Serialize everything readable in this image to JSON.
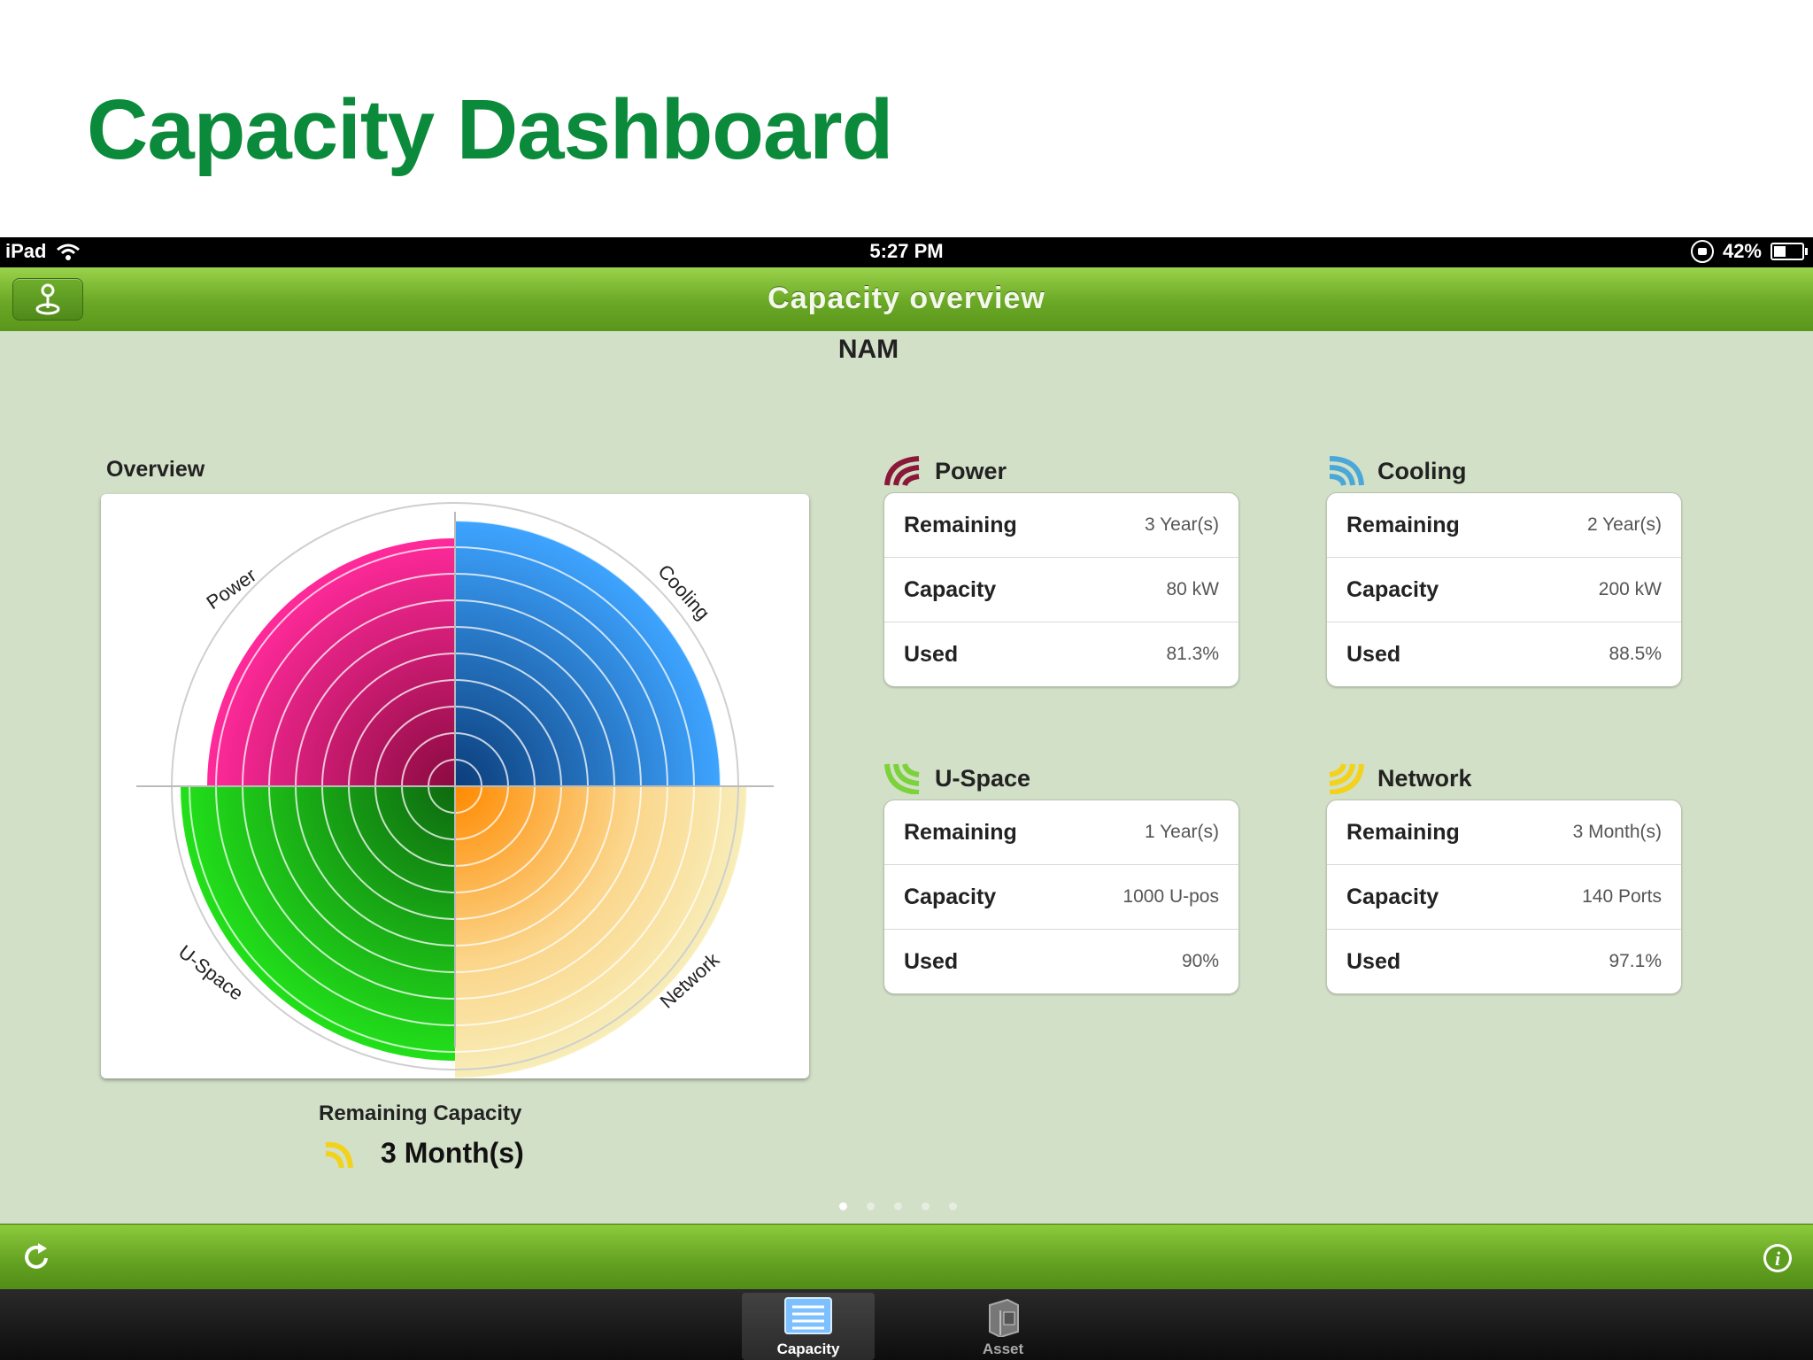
{
  "slide": {
    "title": "Capacity Dashboard"
  },
  "status_bar": {
    "device": "iPad",
    "time": "5:27 PM",
    "battery": "42%",
    "battery_level": 0.42
  },
  "nav": {
    "title": "Capacity overview",
    "left_button_icon": "location-pin-icon"
  },
  "region": "NAM",
  "overview": {
    "label": "Overview",
    "quadrant_labels": {
      "power": "Power",
      "cooling": "Cooling",
      "uspace": "U-Space",
      "network": "Network"
    },
    "colors": {
      "power": "#e0157d",
      "cooling": "#2f8fe8",
      "uspace": "#22c416",
      "network": "#f39a1c"
    },
    "remaining_label": "Remaining Capacity",
    "remaining_value": "3 Month(s)"
  },
  "panels": [
    {
      "name": "Power",
      "icon": "power-arc-icon",
      "color": "#8a1838",
      "rows": [
        {
          "k": "Remaining",
          "v": "3 Year(s)"
        },
        {
          "k": "Capacity",
          "v": "80 kW"
        },
        {
          "k": "Used",
          "v": "81.3%"
        }
      ]
    },
    {
      "name": "Cooling",
      "icon": "cooling-arc-icon",
      "color": "#4aa8d8",
      "rows": [
        {
          "k": "Remaining",
          "v": "2 Year(s)"
        },
        {
          "k": "Capacity",
          "v": "200 kW"
        },
        {
          "k": "Used",
          "v": "88.5%"
        }
      ]
    },
    {
      "name": "U-Space",
      "icon": "uspace-arc-icon",
      "color": "#7cd23a",
      "rows": [
        {
          "k": "Remaining",
          "v": "1 Year(s)"
        },
        {
          "k": "Capacity",
          "v": "1000 U-pos"
        },
        {
          "k": "Used",
          "v": "90%"
        }
      ]
    },
    {
      "name": "Network",
      "icon": "network-arc-icon",
      "color": "#f2d21a",
      "rows": [
        {
          "k": "Remaining",
          "v": "3 Month(s)"
        },
        {
          "k": "Capacity",
          "v": "140 Ports"
        },
        {
          "k": "Used",
          "v": "97.1%"
        }
      ]
    }
  ],
  "page_indicator": {
    "count": 5,
    "active": 0
  },
  "toolbar": {
    "refresh_icon": "refresh-icon",
    "info_icon": "info-icon"
  },
  "tabs": [
    {
      "label": "Capacity",
      "icon": "capacity-list-icon",
      "active": true
    },
    {
      "label": "Asset",
      "icon": "asset-server-icon",
      "active": false
    }
  ]
}
